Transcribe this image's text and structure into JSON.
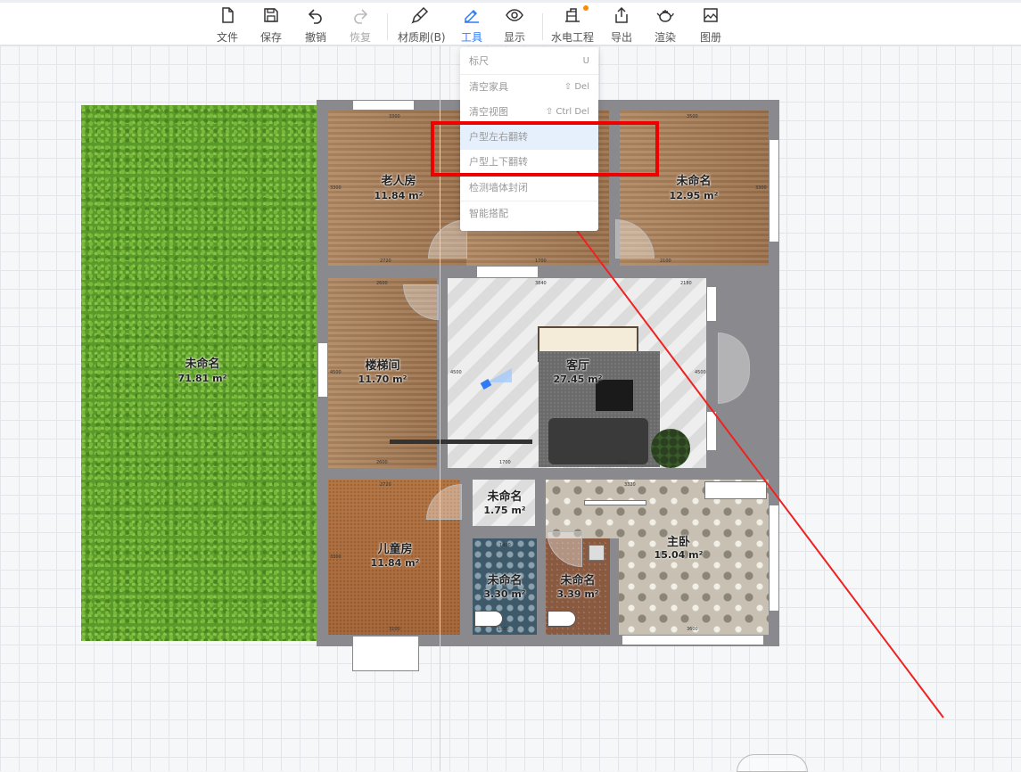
{
  "toolbar": {
    "items": [
      {
        "label": "文件",
        "icon": "file-icon"
      },
      {
        "label": "保存",
        "icon": "save-icon"
      },
      {
        "label": "撤销",
        "icon": "undo-icon"
      },
      {
        "label": "恢复",
        "icon": "redo-icon"
      },
      {
        "label": "材质刷(B)",
        "icon": "brush-icon"
      },
      {
        "label": "工具",
        "icon": "tools-icon"
      },
      {
        "label": "显示",
        "icon": "eye-icon"
      },
      {
        "label": "水电工程",
        "icon": "plumbing-icon"
      },
      {
        "label": "导出",
        "icon": "export-icon"
      },
      {
        "label": "渲染",
        "icon": "teapot-icon"
      },
      {
        "label": "图册",
        "icon": "album-icon"
      }
    ],
    "active": "工具",
    "accent": "#2f7bf5"
  },
  "menu": {
    "items": [
      {
        "label": "标尺",
        "shortcut": "U"
      },
      {
        "label": "清空家具",
        "shortcut": "⇧ Del"
      },
      {
        "label": "清空视图",
        "shortcut": "⇧ Ctrl Del"
      },
      {
        "label": "户型左右翻转",
        "shortcut": ""
      },
      {
        "label": "户型上下翻转",
        "shortcut": ""
      },
      {
        "label": "检测墙体封闭",
        "shortcut": ""
      },
      {
        "label": "智能搭配",
        "shortcut": ""
      }
    ],
    "highlight_color": "#ee0000"
  },
  "floorplan": {
    "rooms": [
      {
        "name": "未命名",
        "area": "71.81 m²"
      },
      {
        "name": "老人房",
        "area": "11.84 m²"
      },
      {
        "name": "未命名",
        "area": "12.95 m²"
      },
      {
        "name": "楼梯间",
        "area": "11.70 m²"
      },
      {
        "name": "客厅",
        "area": "27.45 m²"
      },
      {
        "name": "未命名",
        "area": "1.75 m²"
      },
      {
        "name": "儿童房",
        "area": "11.84 m²"
      },
      {
        "name": "主卧",
        "area": "15.04 m²"
      },
      {
        "name": "未命名",
        "area": "3.30 m²"
      },
      {
        "name": "未命名",
        "area": "3.39 m²"
      }
    ],
    "dims": [
      "3300",
      "3500",
      "3300",
      "3300",
      "2720",
      "2100",
      "1700",
      "2600",
      "3840",
      "2180",
      "4500",
      "4500",
      "4500",
      "2600",
      "1700",
      "2900",
      "2720",
      "3300",
      "1400",
      "3320",
      "3100",
      "1500",
      "3600"
    ]
  }
}
